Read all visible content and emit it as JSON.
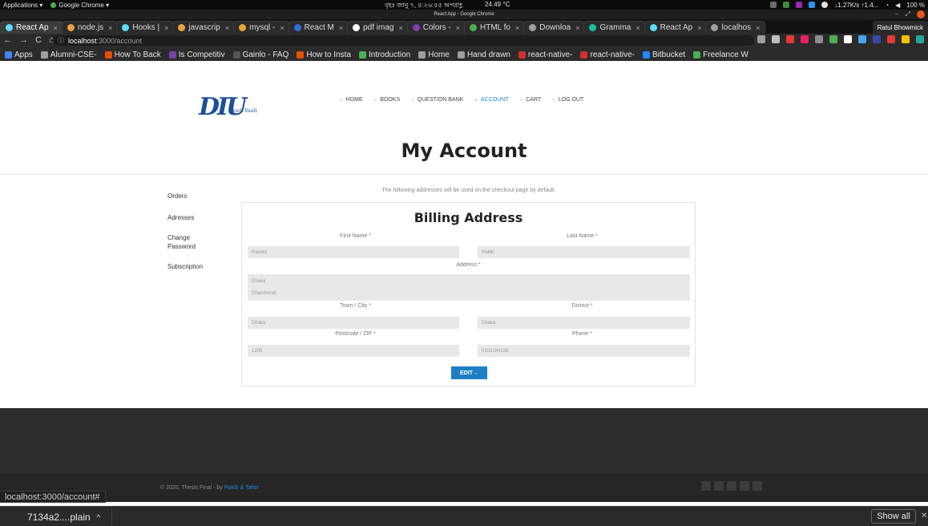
{
  "os": {
    "applications": "Applications ▾",
    "chrome_menu": "Google Chrome ▾",
    "clock": "বৃহঃ জানু ৭, ৪:২৬:৫৫ অপরাহ্ণ",
    "temperature": "24.49 °C",
    "network": "↓1.27K/s ↑1.4...",
    "battery": "100 %"
  },
  "window": {
    "title": "React App - Google Chrome"
  },
  "tabs": [
    {
      "label": "React Ap",
      "color": "#61dafb",
      "active": true
    },
    {
      "label": "node.js",
      "color": "#e8a33c"
    },
    {
      "label": "Hooks |",
      "color": "#61dafb"
    },
    {
      "label": "javascrip",
      "color": "#e8a33c"
    },
    {
      "label": "mysql -",
      "color": "#e8a33c"
    },
    {
      "label": "React M",
      "color": "#2f6fdb"
    },
    {
      "label": "pdf imag",
      "color": "#ffffff"
    },
    {
      "label": "Colors -",
      "color": "#7b3fb0"
    },
    {
      "label": "HTML fo",
      "color": "#4caf50"
    },
    {
      "label": "Downloa",
      "color": "#9e9e9e"
    },
    {
      "label": "Gramma",
      "color": "#15c39a"
    },
    {
      "label": "React Ap",
      "color": "#61dafb"
    },
    {
      "label": "localhos",
      "color": "#9e9e9e"
    }
  ],
  "profile_name": "Ratul Bhowmick",
  "omnibox": {
    "host": "localhost",
    "path": ":3000/account"
  },
  "bookmarks": [
    {
      "label": "Apps",
      "color": "#4285f4"
    },
    {
      "label": "Alumni-CSE-",
      "color": "#9e9e9e"
    },
    {
      "label": "How To Back",
      "color": "#e65100"
    },
    {
      "label": "Is Competitiv",
      "color": "#7b3fb0"
    },
    {
      "label": "Gainlo - FAQ",
      "color": "#555555"
    },
    {
      "label": "How to Insta",
      "color": "#e65100"
    },
    {
      "label": "Introduction",
      "color": "#4caf50"
    },
    {
      "label": "Home",
      "color": "#9e9e9e"
    },
    {
      "label": "Hand drawn",
      "color": "#9e9e9e"
    },
    {
      "label": "react-native-",
      "color": "#d32f2f"
    },
    {
      "label": "react-native-",
      "color": "#d32f2f"
    },
    {
      "label": "Bitbucket",
      "color": "#2684ff"
    },
    {
      "label": "Freelance W",
      "color": "#4caf50"
    }
  ],
  "site": {
    "logo_mark": "DIU",
    "logo_sub": "Book Vault",
    "nav": [
      {
        "label": "HOME",
        "active": false
      },
      {
        "label": "BOOKS",
        "active": false
      },
      {
        "label": "QUESTION BANK",
        "active": false
      },
      {
        "label": "ACCOUNT",
        "active": true
      },
      {
        "label": "CART",
        "active": false
      },
      {
        "label": "LOG OUT",
        "active": false
      }
    ],
    "page_title": "My Account",
    "sidebar": [
      "Orders",
      "Adresses",
      "Change Password",
      "Subscription"
    ],
    "notice": "The following addresses will be used on the checkout page by default.",
    "billing": {
      "heading": "Billing Address",
      "first_name_label": "First Name *",
      "first_name_value": "Rashid",
      "last_name_label": "Last Name *",
      "last_name_value": "Rakib",
      "address_label": "Address *",
      "address_line1": "Dhaka",
      "address_line2": "Dhanmondi",
      "town_label": "Town / City *",
      "town_value": "Dhaka",
      "district_label": "District *",
      "district_value": "Dhaka",
      "postcode_label": "Postcode / ZIP *",
      "postcode_value": "1209",
      "phone_label": "Phone *",
      "phone_value": "0152184158",
      "edit_label": "EDIT→"
    },
    "footer": {
      "copyright_prefix": "© 2020, Thesis Final - by ",
      "authors": "Rakib & Tafsir"
    }
  },
  "status_url": "localhost:3000/account#",
  "downloads": {
    "file": "7134a2....plain",
    "show_all": "Show all"
  }
}
